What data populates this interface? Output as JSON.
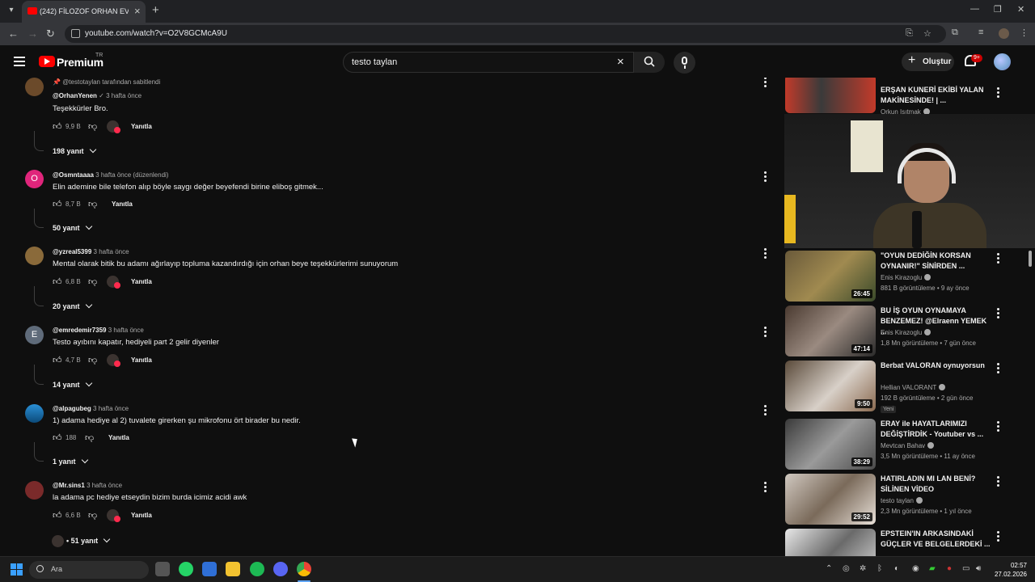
{
  "browser": {
    "tab_title": "(242) FİLOZOF ORHAN EV ZİYA",
    "url": "youtube.com/watch?v=O2V8GCMcA9U"
  },
  "header": {
    "brand": "Premium",
    "region": "TR",
    "search_value": "testo taylan",
    "create_label": "Oluştur",
    "notif_badge": "9+"
  },
  "comments": [
    {
      "pinned_by": "@testotaylan tarafından sabitlendi",
      "author": "@OrhanYenen",
      "verified": true,
      "time": "3 hafta önce",
      "text": "Teşekkürler Bro.",
      "likes": "9,9 B",
      "creator_heart": true,
      "reply_label": "Yanıtla",
      "replies": "198 yanıt"
    },
    {
      "avatar_letter": "O",
      "avatar_color": "#e0257b",
      "author": "@Osmntaaaa",
      "time": "3 hafta önce (düzenlendi)",
      "text": "Elin ademine bile telefon alıp böyle saygı değer beyefendi birine eliboş gitmek...",
      "likes": "8,7 B",
      "creator_heart": false,
      "reply_label": "Yanıtla",
      "replies": "50 yanıt"
    },
    {
      "author": "@yzreal5399",
      "time": "3 hafta önce",
      "text": "Mental olarak bitik bu adamı ağırlayıp topluma kazandırdığı için orhan beye teşekkürlerimi sunuyorum",
      "likes": "6,8 B",
      "creator_heart": true,
      "reply_label": "Yanıtla",
      "replies": "20 yanıt"
    },
    {
      "avatar_letter": "E",
      "avatar_color": "#5f6b7a",
      "author": "@emredemir7359",
      "time": "3 hafta önce",
      "text": "Testo ayıbını kapatır, hediyeli part 2 gelir diyenler",
      "likes": "4,7 B",
      "creator_heart": true,
      "reply_label": "Yanıtla",
      "replies": "14 yanıt"
    },
    {
      "author": "@alpagubeg",
      "time": "3 hafta önce",
      "text": "1) adama hediye al 2) tuvalete girerken şu mikrofonu ört birader bu nedir.",
      "likes": "188",
      "creator_heart": false,
      "reply_label": "Yanıtla",
      "replies": "1 yanıt"
    },
    {
      "author": "@Mr.sins1",
      "time": "3 hafta önce",
      "text": "la adama pc hediye etseydin bizim burda icimiz acidi awk",
      "likes": "6,6 B",
      "creator_heart": true,
      "reply_label": "Yanıtla",
      "replies": "51 yanıt"
    }
  ],
  "sidebar": {
    "videos": [
      {
        "title": "ERŞAN KUNERİ EKİBİ YALAN MAKİNESİNDE! | ...",
        "channel": "Orkun Işıtmak",
        "meta": "",
        "duration": ""
      },
      {
        "title": "\"OYUN DEDİĞİN KORSAN OYNANIR!\" SİNİRDEN ...",
        "channel": "Enis Kirazoglu",
        "meta": "881 B görüntüleme • 9 ay önce",
        "duration": "26:45"
      },
      {
        "title": "BU İŞ OYUN OYNAMAYA BENZEMEZ! @Elraenn YEMEK ...",
        "channel": "Enis Kirazoglu",
        "meta": "1,8 Mn görüntüleme • 7 gün önce",
        "duration": "47:14"
      },
      {
        "title": "Berbat VALORAN oynuyorsun",
        "channel": "Hellian VALORANT",
        "meta": "192 B görüntüleme • 2 gün önce",
        "duration": "9:50",
        "badge": "Yeni"
      },
      {
        "title": "ERAY ile HAYATLARIMIZI DEĞİŞTİRDİK - Youtuber vs ...",
        "channel": "Mevtcan Bahav",
        "meta": "3,5 Mn görüntüleme • 11 ay önce",
        "duration": "38:29"
      },
      {
        "title": "HATIRLADIN MI LAN BENİ? SİLİNEN VİDEO",
        "channel": "testo taylan",
        "meta": "2,3 Mn görüntüleme • 1 yıl önce",
        "duration": "29:52"
      },
      {
        "title": "EPSTEIN'IN ARKASINDAKİ GÜÇLER VE BELGELERDEKİ ...",
        "channel": "",
        "meta": "",
        "duration": ""
      }
    ]
  },
  "taskbar": {
    "search_placeholder": "Ara",
    "time": "02:57",
    "date": "27.02.2026"
  },
  "colors": {
    "brand_red": "#ff0000",
    "background": "#0f0f0f",
    "heart": "#ff2a4d"
  }
}
